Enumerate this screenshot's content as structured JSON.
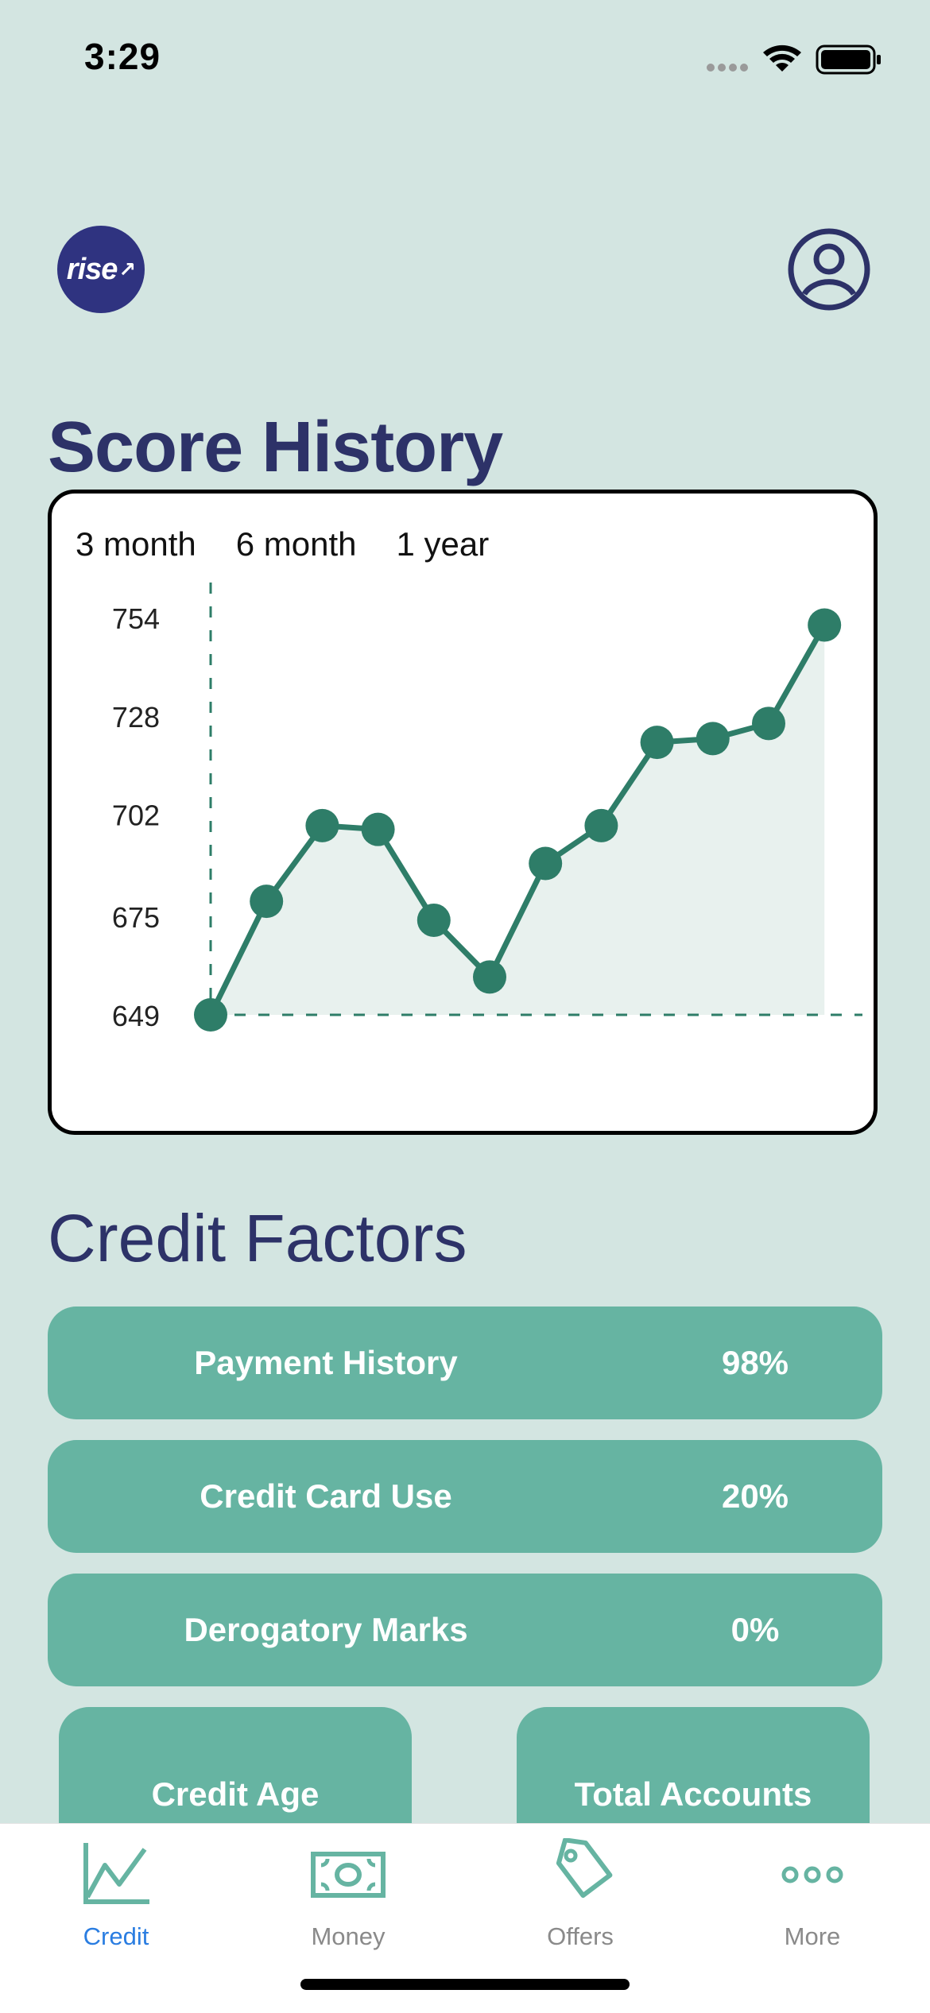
{
  "status_bar": {
    "time": "3:29"
  },
  "header": {
    "logo_text": "rise"
  },
  "score_history": {
    "title": "Score History",
    "range_tabs": [
      "3 month",
      "6 month",
      "1 year"
    ]
  },
  "chart_data": {
    "type": "line",
    "y_ticks": [
      754,
      728,
      702,
      675,
      649
    ],
    "ylim": [
      649,
      754
    ],
    "values": [
      649,
      679,
      699,
      698,
      674,
      659,
      689,
      699,
      721,
      722,
      726,
      752
    ],
    "color": "#2e7d68",
    "fill": "#e8f1ee",
    "grid": false
  },
  "credit_factors": {
    "title": "Credit Factors",
    "items": [
      {
        "label": "Payment History",
        "value": "98%"
      },
      {
        "label": "Credit Card Use",
        "value": "20%"
      },
      {
        "label": "Derogatory Marks",
        "value": "0%"
      }
    ],
    "tiles": [
      {
        "label": "Credit Age"
      },
      {
        "label": "Total Accounts"
      }
    ]
  },
  "tabbar": {
    "items": [
      {
        "label": "Credit",
        "icon": "chart-icon",
        "active": true
      },
      {
        "label": "Money",
        "icon": "banknote-icon",
        "active": false
      },
      {
        "label": "Offers",
        "icon": "tag-icon",
        "active": false
      },
      {
        "label": "More",
        "icon": "more-icon",
        "active": false
      }
    ]
  },
  "colors": {
    "background": "#d3e5e1",
    "accent": "#66b4a2",
    "heading": "#2d3268",
    "active_tab": "#2a7de1"
  }
}
